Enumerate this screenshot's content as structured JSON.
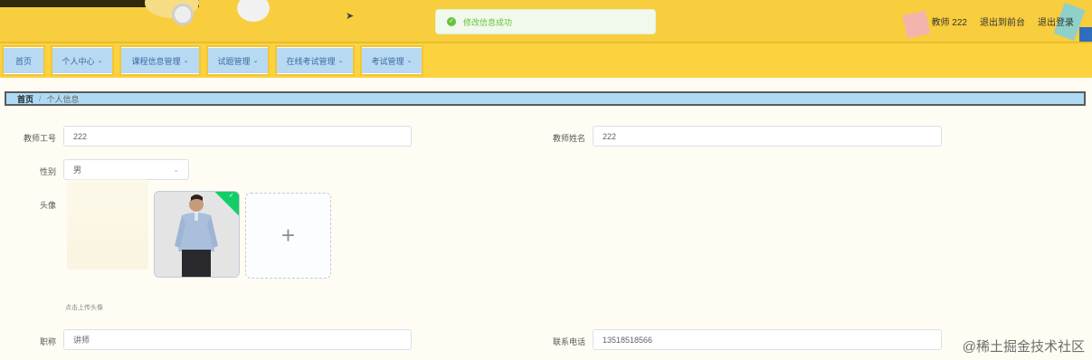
{
  "header": {
    "window_title": "",
    "toast_message": "修改信息成功",
    "user_label": "教师 222",
    "exit_frontend": "退出到前台",
    "logout": "退出登录"
  },
  "nav": {
    "items": [
      {
        "label": "首页",
        "has_dropdown": false
      },
      {
        "label": "个人中心",
        "has_dropdown": true
      },
      {
        "label": "课程信息管理",
        "has_dropdown": true
      },
      {
        "label": "试题管理",
        "has_dropdown": true
      },
      {
        "label": "在线考试管理",
        "has_dropdown": true
      },
      {
        "label": "考试管理",
        "has_dropdown": true
      }
    ]
  },
  "breadcrumb": {
    "home": "首页",
    "separator": "/",
    "current": "个人信息"
  },
  "form": {
    "teacher_id_label": "教师工号",
    "teacher_id_value": "222",
    "teacher_name_label": "教师姓名",
    "teacher_name_value": "222",
    "gender_label": "性别",
    "gender_value": "男",
    "avatar_label": "头像",
    "avatar_hint": "点击上传头像",
    "title_label": "职称",
    "title_value": "讲师",
    "phone_label": "联系电话",
    "phone_value": "13518518566"
  },
  "watermark": "@稀土掘金技术社区",
  "colors": {
    "header_bg": "#f8cd3e",
    "nav_bg": "#fcd23f",
    "breadcrumb_bg": "#aedbf3",
    "success": "#67c23a"
  }
}
